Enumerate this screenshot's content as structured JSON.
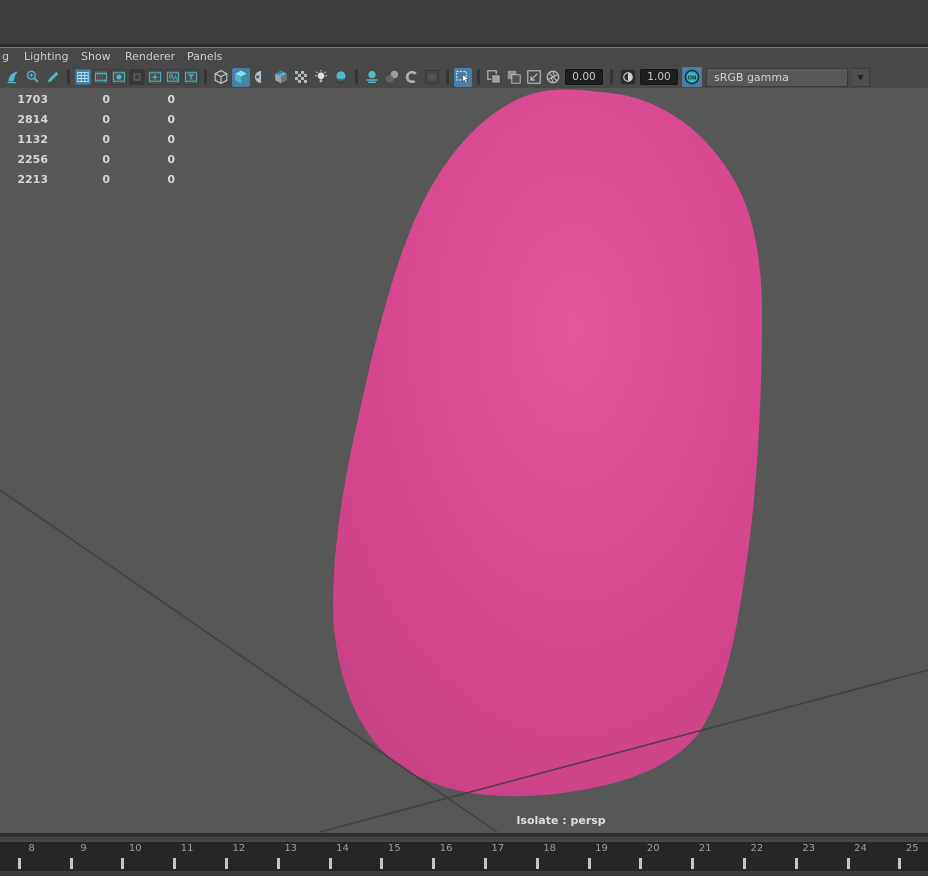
{
  "menubar": {
    "items": [
      {
        "label": "g"
      },
      {
        "label": "Lighting"
      },
      {
        "label": "Show"
      },
      {
        "label": "Renderer"
      },
      {
        "label": "Panels"
      }
    ]
  },
  "toolbar": {
    "icons": [
      {
        "name": "sail-icon"
      },
      {
        "name": "pan-zoom-magnifier-icon"
      },
      {
        "name": "pencil-icon"
      },
      {
        "sep": true
      },
      {
        "name": "grid-icon",
        "boxed": true,
        "highlighted": true
      },
      {
        "name": "film-gate-icon",
        "boxed": true
      },
      {
        "name": "resolution-gate-icon",
        "boxed": true
      },
      {
        "name": "gate-mask-icon",
        "boxed": true,
        "dark": true
      },
      {
        "name": "field-chart-icon",
        "boxed": true
      },
      {
        "name": "safe-action-icon",
        "boxed": true
      },
      {
        "name": "safe-title-icon",
        "boxed": true
      },
      {
        "sep": true
      },
      {
        "name": "wireframe-cube-icon"
      },
      {
        "name": "shaded-cube-icon",
        "highlighted": true
      },
      {
        "name": "material-sphere-icon"
      },
      {
        "name": "textured-cube-icon"
      },
      {
        "name": "checker-icon"
      },
      {
        "name": "lights-icon"
      },
      {
        "name": "shadows-icon"
      },
      {
        "sep": true
      },
      {
        "name": "ssao-icon"
      },
      {
        "name": "motion-blur-icon"
      },
      {
        "name": "anti-alias-icon"
      },
      {
        "name": "blank-swatch-icon"
      },
      {
        "sep": true
      },
      {
        "name": "isolate-select-icon",
        "highlighted": true
      },
      {
        "sep": true
      },
      {
        "name": "xray-icon"
      },
      {
        "name": "xray-joints-icon"
      },
      {
        "name": "resize-arrow-icon"
      },
      {
        "sep": true
      }
    ],
    "exposure_icon": "aperture-icon",
    "exposure_value": "0.00",
    "contrast_icon": "contrast-icon",
    "contrast_value": "1.00",
    "gamma_on_label": "ON",
    "colorspace_selected": "sRGB gamma",
    "accent_color": "#4a7fa5",
    "icon_teal_color": "#4fb9cc"
  },
  "viewport": {
    "hud_rows": [
      [
        "1703",
        "0",
        "0"
      ],
      [
        "2814",
        "0",
        "0"
      ],
      [
        "1132",
        "0",
        "0"
      ],
      [
        "2256",
        "0",
        "0"
      ],
      [
        "2213",
        "0",
        "0"
      ]
    ],
    "isolate_label": "Isolate : persp",
    "background_color": "#575757",
    "object_color": "#d7488f",
    "object_gradient": [
      "#e2569d",
      "#d7488f",
      "#c64083"
    ],
    "grid_line_color": "#3f3c40"
  },
  "timeline": {
    "frames": [
      8,
      9,
      10,
      11,
      12,
      13,
      14,
      15,
      16,
      17,
      18,
      19,
      20,
      21,
      22,
      23,
      24,
      25
    ]
  }
}
